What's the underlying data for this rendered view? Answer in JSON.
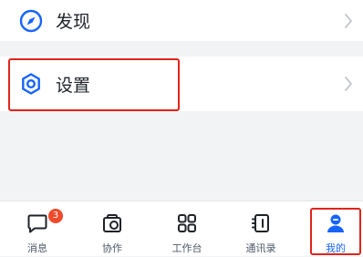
{
  "menu": {
    "discover": {
      "label": "发现",
      "icon": "compass-icon"
    },
    "settings": {
      "label": "设置",
      "icon": "gear-icon"
    }
  },
  "tabbar": {
    "active_tab": "我的",
    "tabs": [
      {
        "label": "消息",
        "icon": "chat-bubble-icon",
        "badge": "3"
      },
      {
        "label": "协作",
        "icon": "collaboration-icon"
      },
      {
        "label": "工作台",
        "icon": "workbench-grid-icon"
      },
      {
        "label": "通讯录",
        "icon": "contacts-book-icon"
      },
      {
        "label": "我的",
        "icon": "user-profile-icon"
      }
    ]
  },
  "colors": {
    "accent": "#1664ff",
    "highlight": "#e0241b",
    "badge": "#ee4b2b",
    "background": "#f2f3f5"
  }
}
